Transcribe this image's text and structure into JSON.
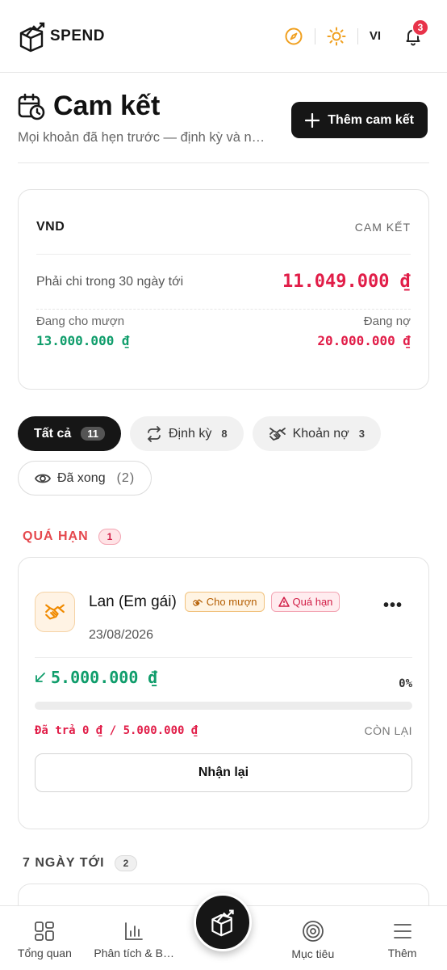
{
  "app": {
    "logo_text": "SPEND"
  },
  "header": {
    "language": "VI",
    "notification_count": "3"
  },
  "page": {
    "title": "Cam kết",
    "subtitle": "Mọi khoản đã hẹn trước — định kỳ và n…",
    "add_button": "Thêm cam kết"
  },
  "summary": {
    "currency": "VND",
    "tag": "CAM KẾT",
    "due_label": "Phải chi trong 30 ngày tới",
    "due_value": "11.049.000 ₫",
    "lending_label": "Đang cho mượn",
    "lending_value": "13.000.000 ₫",
    "debt_label": "Đang nợ",
    "debt_value": "20.000.000 ₫"
  },
  "filters": [
    {
      "label": "Tất cả",
      "count": "11",
      "icon": "none",
      "active": true
    },
    {
      "label": "Định kỳ",
      "count": "8",
      "icon": "repeat-icon"
    },
    {
      "label": "Khoản nợ",
      "count": "3",
      "icon": "handshake-icon"
    },
    {
      "label": "Đã xong",
      "count": "(2)",
      "icon": "eye-icon"
    }
  ],
  "sections": {
    "overdue": {
      "title": "QUÁ HẠN",
      "count": "1"
    },
    "next7": {
      "title": "7 NGÀY TỚI",
      "count": "2"
    }
  },
  "card": {
    "name": "Lan (Em gái)",
    "tag_type": "Cho mượn",
    "tag_status": "Quá hạn",
    "date": "23/08/2026",
    "amount": "5.000.000 ₫",
    "percent": "0%",
    "progress": 0,
    "paid_text": "Đã trả 0 ₫ / 5.000.000 ₫",
    "remain_label": "CÒN LẠI",
    "action_button": "Nhận lại"
  },
  "nav": {
    "items": [
      "Tổng quan",
      "Phân tích & B…",
      "Mục tiêu",
      "Thêm"
    ]
  },
  "colors": {
    "accent_dark": "#161616",
    "expense_red": "#e11d48",
    "income_green": "#0f9d6b",
    "warning_orange": "#f0a020"
  }
}
